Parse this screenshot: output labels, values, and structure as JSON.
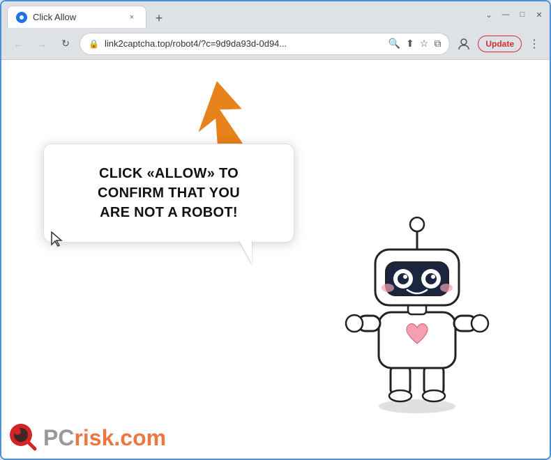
{
  "browser": {
    "tab": {
      "favicon_label": "●",
      "title": "Click Allow",
      "close_label": "×"
    },
    "new_tab_label": "+",
    "window_controls": {
      "minimize": "—",
      "maximize": "□",
      "close": "✕"
    },
    "nav": {
      "back_label": "←",
      "forward_label": "→",
      "refresh_label": "↻",
      "address": "link2captcha.top/robot4/?c=9d9da93d-0d94...",
      "search_icon": "🔍",
      "share_icon": "⬆",
      "bookmark_icon": "☆",
      "extensions_icon": "⧉",
      "profile_icon": "👤",
      "update_label": "Update",
      "menu_label": "⋮"
    }
  },
  "page": {
    "bubble_line1": "CLICK «ALLOW» TO CONFIRM THAT YOU",
    "bubble_line2": "ARE NOT A ROBOT!",
    "pcrisk_pc": "PC",
    "pcrisk_risk": "risk.com"
  },
  "colors": {
    "accent_blue": "#4a90d9",
    "arrow_orange": "#e8821a",
    "update_red": "#d32f2f",
    "pcrisk_orange": "#e86020",
    "pcrisk_grey": "#888888"
  }
}
